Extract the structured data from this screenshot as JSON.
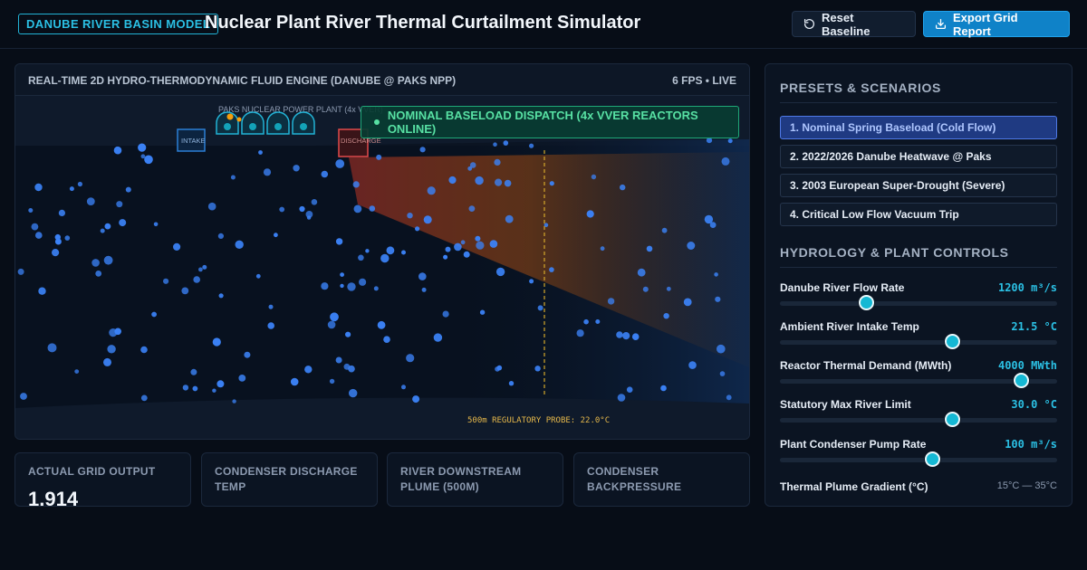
{
  "header": {
    "tag": "DANUBE RIVER BASIN MODEL",
    "title": "Nuclear Plant River Thermal Curtailment Simulator",
    "reset_label": "Reset Baseline",
    "export_label": "Export Grid Report",
    "reset_icon": "rotate-ccw-icon",
    "export_icon": "download-icon",
    "accent_color": "#22b3d6",
    "primary_button_color": "#0f82c8"
  },
  "engine": {
    "title": "REAL-TIME 2D HYDRO-THERMODYNAMIC FLUID ENGINE (DANUBE @ PAKS NPP)",
    "fps_label": "6 FPS • LIVE",
    "plant_label": "PAKS NUCLEAR POWER PLANT (4x VVER)",
    "intake_label": "INTAKE",
    "discharge_label": "DISCHARGE",
    "probe_label": "500m REGULATORY PROBE: 22.0°C",
    "status_text": "NOMINAL BASELOAD DISPATCH (4x VVER REACTORS ONLINE)",
    "status_color": "#57e0a3",
    "particle_color": "#3b82f6",
    "plume_color": "#c2410c"
  },
  "metrics": [
    {
      "label": "ACTUAL GRID OUTPUT",
      "value": "1,914"
    },
    {
      "label": "CONDENSER DISCHARGE TEMP",
      "value": ""
    },
    {
      "label": "RIVER DOWNSTREAM PLUME (500M)",
      "value": ""
    },
    {
      "label": "CONDENSER BACKPRESSURE",
      "value": ""
    }
  ],
  "presets": {
    "heading": "PRESETS & SCENARIOS",
    "items": [
      {
        "label": "1. Nominal Spring Baseload (Cold Flow)",
        "active": true
      },
      {
        "label": "2. 2022/2026 Danube Heatwave @ Paks",
        "active": false
      },
      {
        "label": "3. 2003 European Super-Drought (Severe)",
        "active": false
      },
      {
        "label": "4. Critical Low Flow Vacuum Trip",
        "active": false
      }
    ]
  },
  "controls": {
    "heading": "HYDROLOGY & PLANT CONTROLS",
    "items": [
      {
        "label": "Danube River Flow Rate",
        "value": "1200 m³/s",
        "level": 0.31
      },
      {
        "label": "Ambient River Intake Temp",
        "value": "21.5 °C",
        "level": 0.62
      },
      {
        "label": "Reactor Thermal Demand (MWth)",
        "value": "4000 MWth",
        "level": 0.87
      },
      {
        "label": "Statutory Max River Limit",
        "value": "30.0 °C",
        "level": 0.62
      },
      {
        "label": "Plant Condenser Pump Rate",
        "value": "100 m³/s",
        "level": 0.55
      }
    ],
    "gradient_label": "Thermal Plume Gradient (°C)",
    "gradient_range": "15°C — 35°C"
  }
}
